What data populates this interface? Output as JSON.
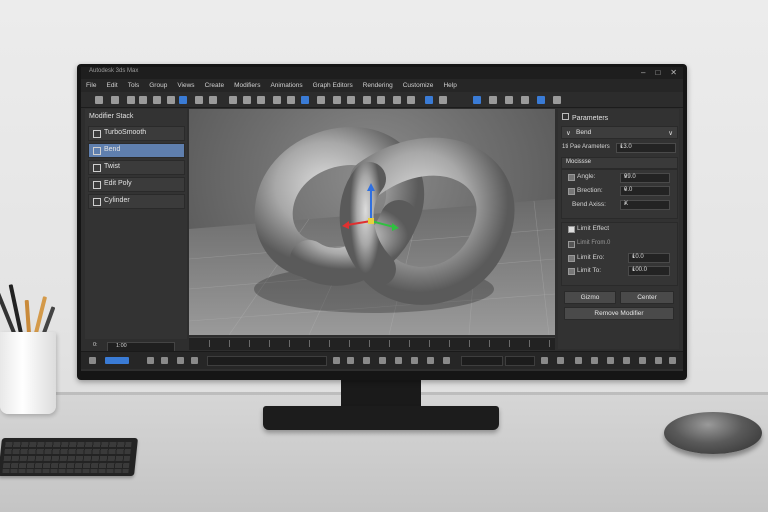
{
  "window": {
    "title": "Autodesk 3ds Max",
    "controls": [
      "–",
      "□",
      "✕"
    ]
  },
  "menu": [
    "File",
    "Edit",
    "Tols",
    "Group",
    "Views",
    "Create",
    "Modifiers",
    "Animations",
    "Graph Editors",
    "Rendering",
    "Customize",
    "Help"
  ],
  "left_panel": {
    "title": "Modifier Stack",
    "items": [
      {
        "label": "TurboSmooth",
        "active": false
      },
      {
        "label": "Bend",
        "active": true
      },
      {
        "label": "Twist",
        "active": false
      },
      {
        "label": "Edit Poly",
        "active": false
      },
      {
        "label": "Cylinder",
        "active": false
      }
    ],
    "frame_label": "0:",
    "frame_value": "1:00"
  },
  "right_panel": {
    "title": "Parameters",
    "bend_header": "Bend",
    "sub_label": "1ti Pae Arameters",
    "sub_value": "13.0",
    "section_label": "Mocissse",
    "params": [
      {
        "label": "Angle:",
        "value": "99.0"
      },
      {
        "label": "Brection:",
        "value": "0.0"
      },
      {
        "label": "Bend Axiss:",
        "value": "X"
      }
    ],
    "limit_effect": "Limit Effect",
    "limit_from": "Limit From.0",
    "limit_ero_label": "Limit Ero:",
    "limit_ero_value": "10.0",
    "limit_to_label": "Limit To:",
    "limit_to_value": "100.0",
    "buttons": {
      "gizmo": "Gizmo",
      "center": "Center",
      "remove": "Remove Modifier"
    }
  },
  "colors": {
    "accent": "#3a7bd5",
    "active_item": "#5f7fae",
    "gizmo_x": "#e03030",
    "gizmo_y": "#30c040",
    "gizmo_z": "#3070e0"
  }
}
